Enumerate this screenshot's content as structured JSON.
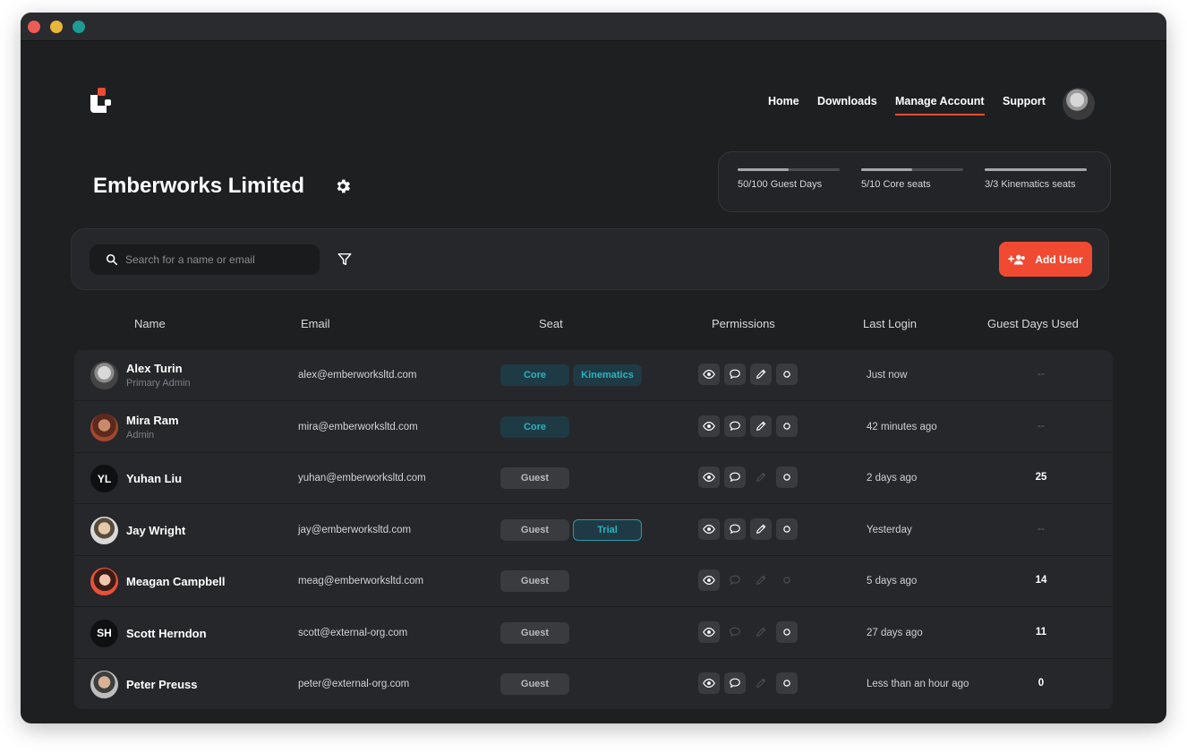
{
  "nav": {
    "items": [
      {
        "label": "Home",
        "active": false
      },
      {
        "label": "Downloads",
        "active": false
      },
      {
        "label": "Manage Account",
        "active": true
      },
      {
        "label": "Support",
        "active": false
      }
    ]
  },
  "org": {
    "name": "Emberworks Limited"
  },
  "quotas": [
    {
      "label": "50/100 Guest Days",
      "fraction": 0.5
    },
    {
      "label": "5/10 Core seats",
      "fraction": 0.5
    },
    {
      "label": "3/3 Kinematics seats",
      "fraction": 1.0
    }
  ],
  "toolbar": {
    "search_placeholder": "Search for a name or email",
    "add_user_label": "Add User"
  },
  "table": {
    "headers": [
      "Name",
      "Email",
      "Seat",
      "Permissions",
      "Last Login",
      "Guest Days Used"
    ],
    "rows": [
      {
        "name": "Alex Turin",
        "role": "Primary Admin",
        "initials": "",
        "email": "alex@emberworksltd.com",
        "seats": [
          "Core",
          "Kinematics"
        ],
        "permissions": {
          "view": true,
          "comment": true,
          "edit": true,
          "other": true
        },
        "last_login": "Just now",
        "guest_days": "--"
      },
      {
        "name": "Mira Ram",
        "role": "Admin",
        "initials": "",
        "email": "mira@emberworksltd.com",
        "seats": [
          "Core"
        ],
        "permissions": {
          "view": true,
          "comment": true,
          "edit": true,
          "other": true
        },
        "last_login": "42 minutes ago",
        "guest_days": "--"
      },
      {
        "name": "Yuhan Liu",
        "role": "",
        "initials": "YL",
        "email": "yuhan@emberworksltd.com",
        "seats": [
          "Guest"
        ],
        "permissions": {
          "view": true,
          "comment": true,
          "edit": false,
          "other": true
        },
        "last_login": "2 days ago",
        "guest_days": "25"
      },
      {
        "name": "Jay Wright",
        "role": "",
        "initials": "",
        "email": "jay@emberworksltd.com",
        "seats": [
          "Guest",
          "Trial"
        ],
        "permissions": {
          "view": true,
          "comment": true,
          "edit": true,
          "other": true
        },
        "last_login": "Yesterday",
        "guest_days": "--"
      },
      {
        "name": "Meagan Campbell",
        "role": "",
        "initials": "",
        "email": "meag@emberworksltd.com",
        "seats": [
          "Guest"
        ],
        "permissions": {
          "view": true,
          "comment": false,
          "edit": false,
          "other": false
        },
        "last_login": "5 days ago",
        "guest_days": "14"
      },
      {
        "name": "Scott Herndon",
        "role": "",
        "initials": "SH",
        "email": "scott@external-org.com",
        "seats": [
          "Guest"
        ],
        "permissions": {
          "view": true,
          "comment": false,
          "edit": false,
          "other": true
        },
        "last_login": "27 days ago",
        "guest_days": "11"
      },
      {
        "name": "Peter Preuss",
        "role": "",
        "initials": "",
        "email": "peter@external-org.com",
        "seats": [
          "Guest"
        ],
        "permissions": {
          "view": true,
          "comment": true,
          "edit": false,
          "other": true
        },
        "last_login": "Less than an hour ago",
        "guest_days": "0"
      }
    ]
  },
  "colors": {
    "accent": "#f04a32",
    "background": "#1e1f21",
    "surface": "#26272a",
    "seat_core": "#2bb3bf",
    "seat_guest": "#b9babd"
  },
  "icons": {
    "logo": "brand-logo-icon",
    "settings": "gear-icon",
    "search": "search-icon",
    "filter": "filter-icon",
    "add_user": "add-user-icon",
    "permissions": [
      "eye-icon",
      "comment-icon",
      "pencil-icon",
      "circle-icon"
    ]
  }
}
